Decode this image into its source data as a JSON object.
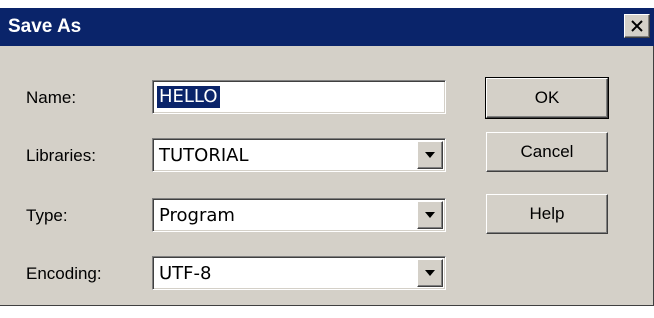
{
  "dialog": {
    "title": "Save As",
    "close_icon": "close-icon"
  },
  "form": {
    "name": {
      "label": "Name:",
      "value": "HELLO"
    },
    "libraries": {
      "label": "Libraries:",
      "value": "TUTORIAL"
    },
    "type": {
      "label": "Type:",
      "value": "Program"
    },
    "encoding": {
      "label": "Encoding:",
      "value": "UTF-8"
    }
  },
  "buttons": {
    "ok": "OK",
    "cancel": "Cancel",
    "help": "Help"
  },
  "colors": {
    "titlebar": "#0a246a",
    "face": "#d4d0c8",
    "selection": "#0a246a"
  }
}
